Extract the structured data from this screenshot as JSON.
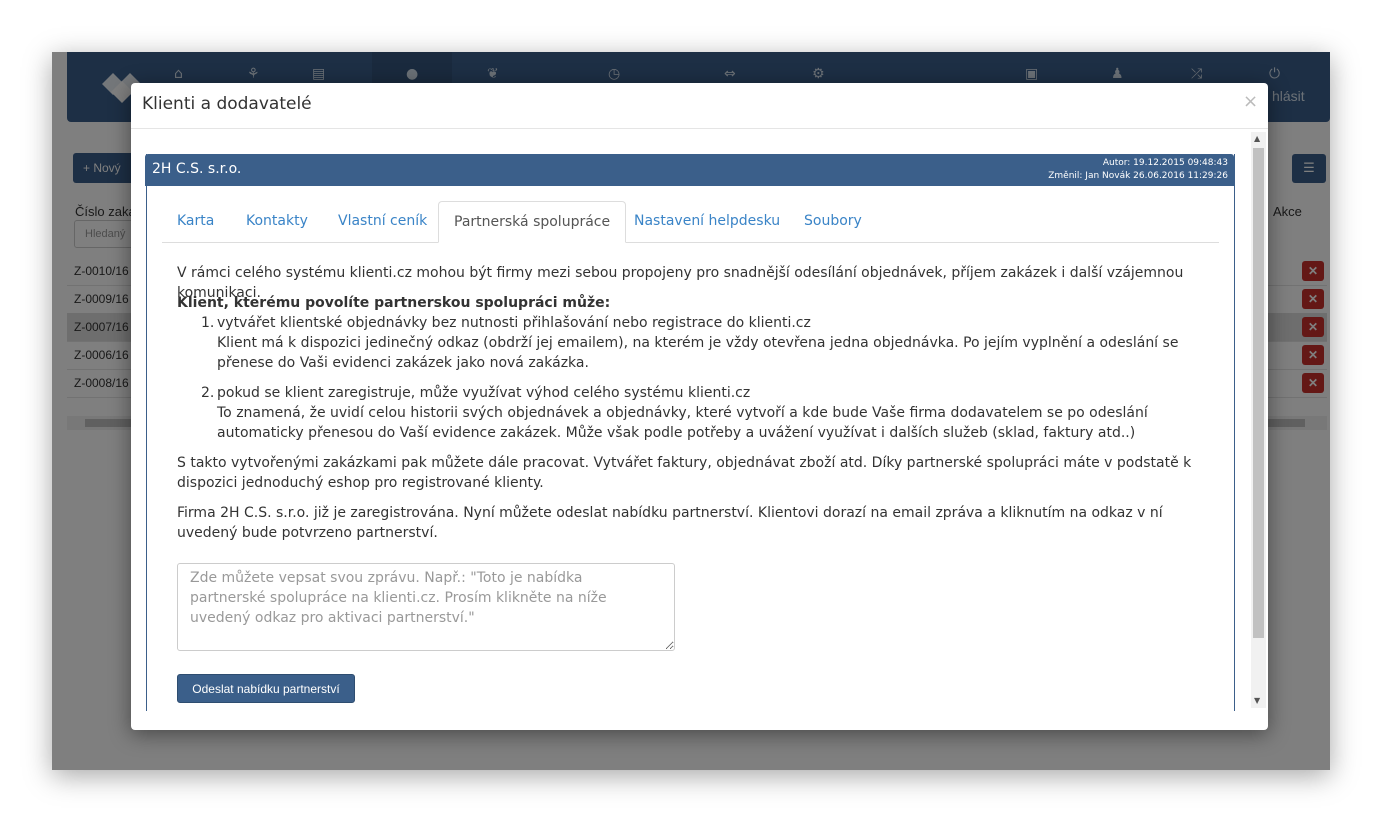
{
  "app": {
    "nav_logout_label": "hlásit",
    "new_button_label": "Nový",
    "list_view_icon": "list-icon",
    "table": {
      "col_number": "Číslo zaká",
      "col_actions": "Akce",
      "search_placeholder": "Hledaný",
      "rows": [
        "Z-0010/16",
        "Z-0009/16",
        "Z-0007/16",
        "Z-0006/16",
        "Z-0008/16"
      ]
    }
  },
  "modal": {
    "title": "Klienti a dodavatelé",
    "close_glyph": "×",
    "client": {
      "name": "2H C.S. s.r.o.",
      "author_line": "Autor: 19.12.2015 09:48:43",
      "changed_line": "Změnil: Jan Novák 26.06.2016 11:29:26"
    },
    "tabs": [
      {
        "label": "Karta"
      },
      {
        "label": "Kontakty"
      },
      {
        "label": "Vlastní ceník"
      },
      {
        "label": "Partnerská spolupráce",
        "active": true
      },
      {
        "label": "Nastavení helpdesku"
      },
      {
        "label": "Soubory"
      }
    ],
    "content": {
      "intro": "V rámci celého systému klienti.cz mohou být firmy mezi sebou propojeny pro snadnější odesílání objednávek, příjem zakázek i další vzájemnou komunikaci.",
      "heading": "Klient, kterému povolíte partnerskou spolupráci může:",
      "items": [
        {
          "num": "1.",
          "line1": "vytvářet klientské objednávky bez nutnosti přihlašování nebo registrace do klienti.cz",
          "line2": "Klient má k dispozici jedinečný odkaz (obdrží jej emailem), na kterém je vždy otevřena jedna objednávka. Po jejím vyplnění a odeslání se přenese do Vaši evidenci zakázek jako nová zakázka."
        },
        {
          "num": "2.",
          "line1": "pokud se klient zaregistruje, může využívat výhod celého systému klienti.cz",
          "line2": "To znamená, že uvidí celou historii svých objednávek a objednávky, které vytvoří a kde bude Vaše firma dodavatelem se po odeslání automaticky přenesou do Vaší evidence zakázek. Může však podle potřeby a uvážení využívat i dalších služeb (sklad, faktury atd..)"
        }
      ],
      "para2": "S takto vytvořenými zakázkami pak můžete dále pracovat. Vytvářet faktury, objednávat zboží atd. Díky partnerské spolupráci máte v podstatě k dispozici jednoduchý eshop pro registrované klienty.",
      "para3": "Firma 2H C.S. s.r.o. již je zaregistrována. Nyní můžete odeslat nabídku partnerství. Klientovi dorazí na email zpráva a kliknutím na odkaz v ní uvedený bude potvrzeno partnerství.",
      "message_placeholder": "Zde můžete vepsat svou zprávu. Např.: \"Toto je nabídka partnerské spolupráce na klienti.cz. Prosím klikněte na níže uvedený odkaz pro aktivaci partnerství.\"",
      "message_value": "",
      "send_button": "Odeslat nabídku partnerství"
    }
  }
}
